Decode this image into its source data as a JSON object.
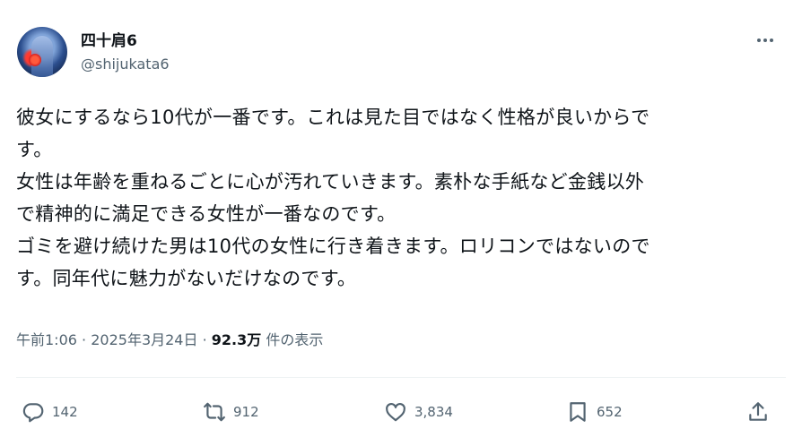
{
  "author": {
    "display_name": "四十肩6",
    "handle": "@shijukata6"
  },
  "post": {
    "lines": [
      "彼女にするなら10代が一番です。これは見た目ではなく性格が良いからで",
      "す。",
      "女性は年齢を重ねるごとに心が汚れていきます。素朴な手紙など金銭以外",
      "で精神的に満足できる女性が一番なのです。",
      "ゴミを避け続けた男は10代の女性に行き着きます。ロリコンではないので",
      "す。同年代に魅力がないだけなのです。"
    ]
  },
  "meta": {
    "time": "午前1:06",
    "separator": "·",
    "date": "2025年3月24日",
    "views_count": "92.3万",
    "views_label": "件の表示"
  },
  "actions": {
    "replies": "142",
    "reposts": "912",
    "likes": "3,834",
    "bookmarks": "652"
  },
  "icons": {
    "reply": "reply-icon",
    "repost": "repost-icon",
    "like": "like-icon",
    "bookmark": "bookmark-icon",
    "share": "share-icon",
    "more": "more-icon"
  },
  "colors": {
    "text": "#0f1419",
    "secondary": "#536471",
    "divider": "#eff3f4"
  }
}
